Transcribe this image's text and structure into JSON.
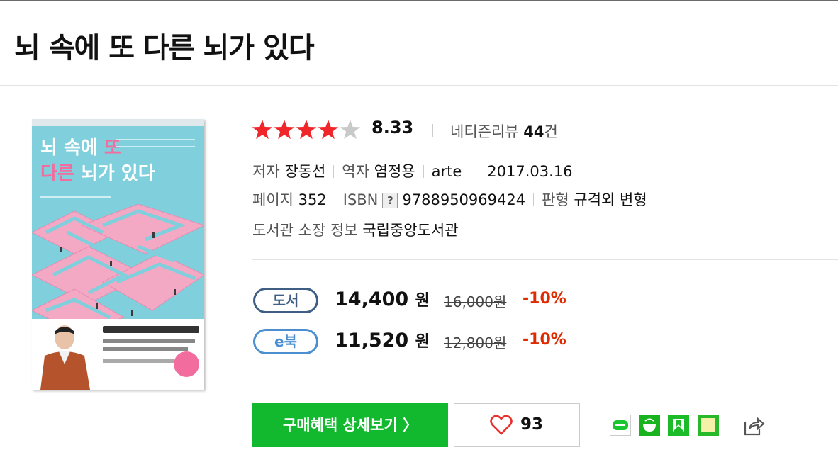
{
  "title": "뇌 속에 또 다른 뇌가 있다",
  "rating": {
    "stars_filled": 4,
    "stars_total": 5,
    "score": "8.33",
    "review_label": "네티즌리뷰",
    "review_count": "44",
    "review_unit": "건"
  },
  "details": {
    "author_label": "저자",
    "author": "장동선",
    "translator_label": "역자",
    "translator": "염정용",
    "publisher": "arte",
    "date": "2017.03.16",
    "pages_label": "페이지",
    "pages": "352",
    "isbn_label": "ISBN",
    "isbn_help": "?",
    "isbn": "9788950969424",
    "format_label": "판형",
    "format": "규격외 변형",
    "library_label": "도서관 소장 정보",
    "library": "국립중앙도서관"
  },
  "prices": [
    {
      "type": "도서",
      "price": "14,400",
      "unit": "원",
      "original": "16,000원",
      "discount": "-10%"
    },
    {
      "type": "e북",
      "price": "11,520",
      "unit": "원",
      "original": "12,800원",
      "discount": "-10%"
    }
  ],
  "actions": {
    "buy_label": "구매혜택 상세보기 〉",
    "like_count": "93"
  },
  "share_icons": [
    "blog-icon",
    "cafe-icon",
    "bookmark-icon",
    "memo-icon",
    "share-icon"
  ],
  "colors": {
    "star": "#f0262a",
    "buy_button": "#12b82e",
    "discount": "#e02a00",
    "book_pill": "#3e5f83",
    "ebook_pill": "#4b8fd1"
  }
}
